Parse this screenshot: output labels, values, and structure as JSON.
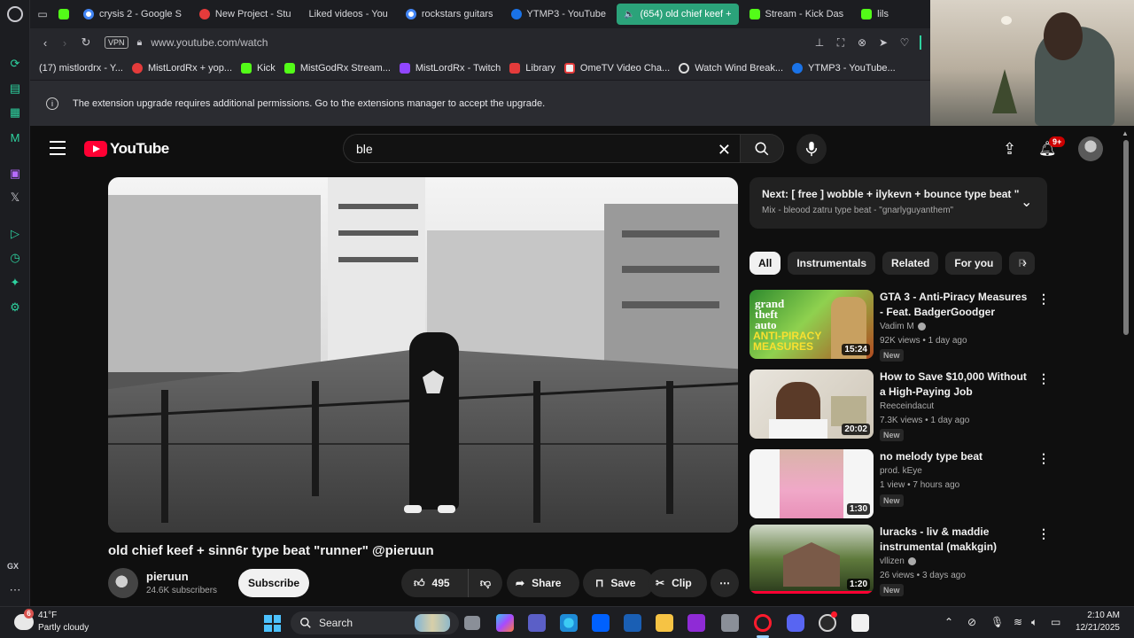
{
  "browser": {
    "tabs": [
      {
        "label": "crysis 2 - Google S",
        "favicon": "google-icon"
      },
      {
        "label": "New Project - Stu",
        "favicon": "studio-icon"
      },
      {
        "label": "Liked videos - You",
        "favicon": "youtube-icon"
      },
      {
        "label": "rockstars guitars",
        "favicon": "google-icon"
      },
      {
        "label": "YTMP3 - YouTube",
        "favicon": "ytmp3-icon"
      },
      {
        "label": "(654) old chief keef +",
        "favicon": "youtube-icon",
        "active": true
      },
      {
        "label": "Stream - Kick Das",
        "favicon": "kick-icon"
      },
      {
        "label": "lils",
        "favicon": "kick-icon"
      }
    ],
    "vpn_label": "VPN",
    "url": "www.youtube.com/watch",
    "bookmarks": [
      {
        "label": "(17) mistlordrx - Y...",
        "favicon": "youtube-icon"
      },
      {
        "label": "MistLordRx + yop...",
        "favicon": "studio-icon"
      },
      {
        "label": "Kick",
        "favicon": "kick-icon"
      },
      {
        "label": "MistGodRx Stream...",
        "favicon": "kick-icon"
      },
      {
        "label": "MistLordRx - Twitch",
        "favicon": "twitch-icon"
      },
      {
        "label": "Library",
        "favicon": "library-icon"
      },
      {
        "label": "OmeTV Video Cha...",
        "favicon": "ometv-icon"
      },
      {
        "label": "Watch Wind Break...",
        "favicon": "wind-icon"
      },
      {
        "label": "YTMP3 - YouTube...",
        "favicon": "ytmp3-icon"
      }
    ],
    "notice": "The extension upgrade requires additional permissions. Go to the extensions manager to accept the upgrade."
  },
  "youtube": {
    "logo_text": "YouTube",
    "search_value": "ble",
    "notifications_badge": "9+",
    "video": {
      "title": "old chief keef + sinn6r type beat \"runner\" @pieruun",
      "channel": "pieruun",
      "subscribers": "24.6K subscribers",
      "subscribe_label": "Subscribe",
      "likes": "495",
      "share_label": "Share",
      "save_label": "Save",
      "clip_label": "Clip"
    },
    "next_up": {
      "title": "Next: [ free ] wobble + ilykevn + bounce type beat \" l...",
      "subtitle": "Mix - bleood zatru type beat - \"gnarlyguyanthem\""
    },
    "chips": [
      "All",
      "Instrumentals",
      "Related",
      "For you",
      "R"
    ],
    "recommendations": [
      {
        "title": "GTA 3 - Anti-Piracy Measures - Feat. BadgerGoodger",
        "channel": "Vadim M",
        "verified": true,
        "meta": "92K views • 1 day ago",
        "badge": "New",
        "duration": "15:24",
        "thumb_text": [
          "grand",
          "theft",
          "auto"
        ],
        "thumb_caption": [
          "ANTI-PIRACY",
          "MEASURES"
        ]
      },
      {
        "title": "How to Save $10,000 Without a High-Paying Job",
        "channel": "Reeceindacut",
        "verified": false,
        "meta": "7.3K views • 1 day ago",
        "badge": "New",
        "duration": "20:02"
      },
      {
        "title": "no melody type beat",
        "channel": "prod. kEye",
        "verified": false,
        "meta": "1 view • 7 hours ago",
        "badge": "New",
        "duration": "1:30"
      },
      {
        "title": "luracks - liv & maddie instrumental (makkgin)",
        "channel": "vllizen",
        "verified": true,
        "meta": "26 views • 3 days ago",
        "badge": "New",
        "duration": "1:20"
      }
    ]
  },
  "taskbar": {
    "weather_temp": "41°F",
    "weather_desc": "Partly cloudy",
    "weather_badge": "6",
    "search_label": "Search",
    "time": "2:10 AM",
    "date": "12/21/2025"
  },
  "sidebar": {
    "gx_label": "GX"
  },
  "colors": {
    "yt_red": "#ff0033",
    "active_tab": "#2ba37a",
    "kick_green": "#53fc18",
    "twitch_purple": "#9146ff",
    "windows_blue": "#4cc2ff"
  }
}
